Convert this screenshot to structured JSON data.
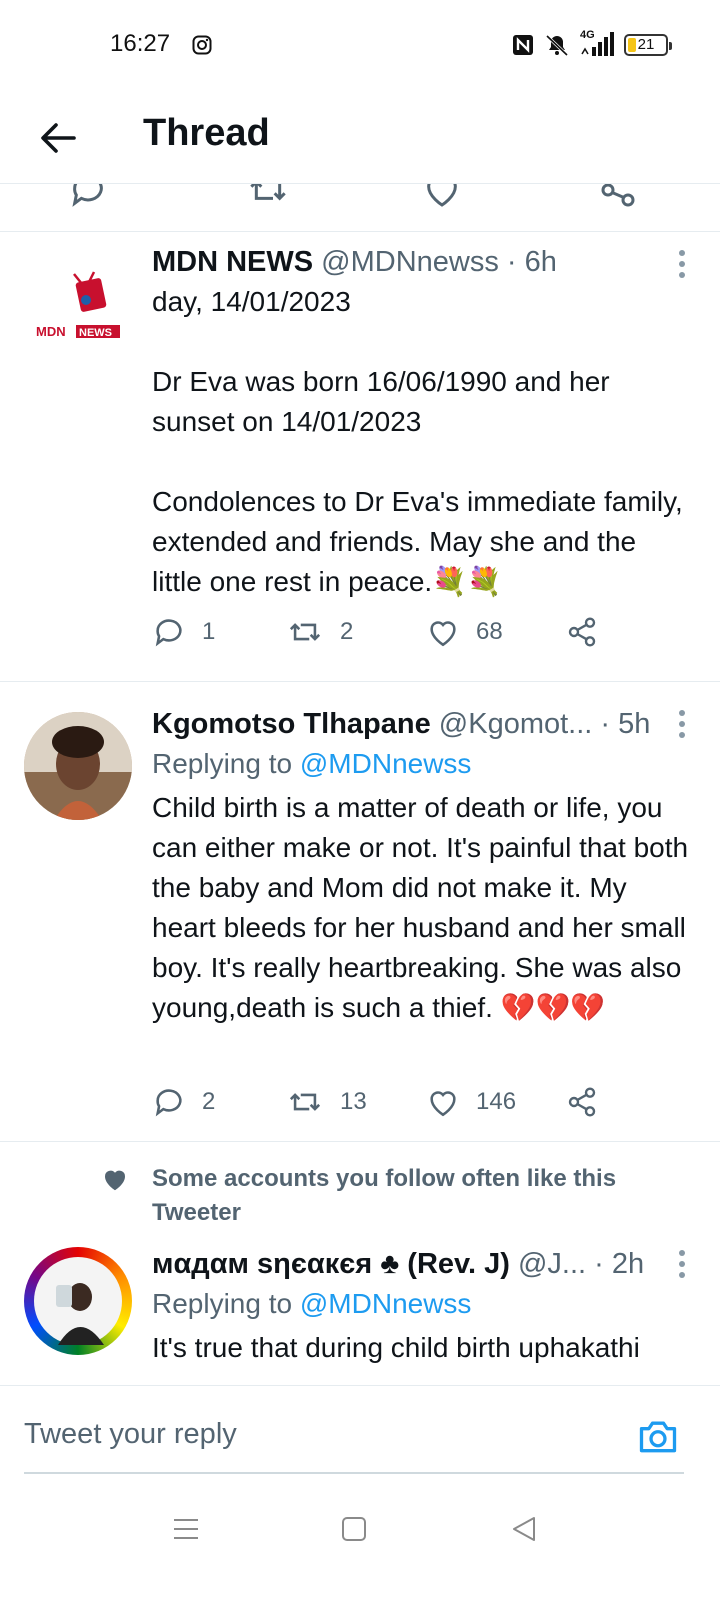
{
  "status_bar": {
    "time": "16:27",
    "network": "4G",
    "battery": "21",
    "battery_level": 0.21,
    "icons": [
      "instagram-icon",
      "nfc-icon",
      "mute-icon",
      "signal-icon",
      "battery-icon"
    ]
  },
  "header": {
    "title": "Thread",
    "back_icon": "arrow-left-icon"
  },
  "tweets": [
    {
      "name": "MDN NEWS",
      "handle": "@MDNnewss · 6h",
      "avatar_label": "MDN NEWS",
      "text": "day, 14/01/2023\n\nDr Eva was born 16/06/1990 and her sunset on 14/01/2023\n\nCondolences to Dr Eva's immediate family, extended and friends. May she and the little one rest in peace.💐💐",
      "replies": "1",
      "retweets": "2",
      "likes": "68"
    },
    {
      "name": "Kgomotso Tlhapane",
      "handle": "@Kgomot... · 5h",
      "replying_prefix": "Replying to",
      "replying_to": "@MDNnewss",
      "text": "Child birth is a matter of death or life, you can either make or not. It's painful that both the baby and Mom did not make it. My heart bleeds for her husband and her small boy. It's really heartbreaking. She was also young,death is such a thief. 💔💔💔",
      "replies": "2",
      "retweets": "13",
      "likes": "146"
    },
    {
      "social_context": "Some accounts you follow often like this Tweeter",
      "name": "мαдαм ѕηєαкєя ♣ (Rev. J)",
      "handle": "@J... · 2h",
      "replying_prefix": "Replying to",
      "replying_to": "@MDNnewss",
      "text": "It's true that during child birth uphakathi"
    }
  ],
  "reply_bar": {
    "placeholder": "Tweet your reply"
  },
  "colors": {
    "accent": "#1d9bf0",
    "secondary_text": "#536471",
    "primary_text": "#0f1419",
    "divider": "#e6ecf0"
  }
}
